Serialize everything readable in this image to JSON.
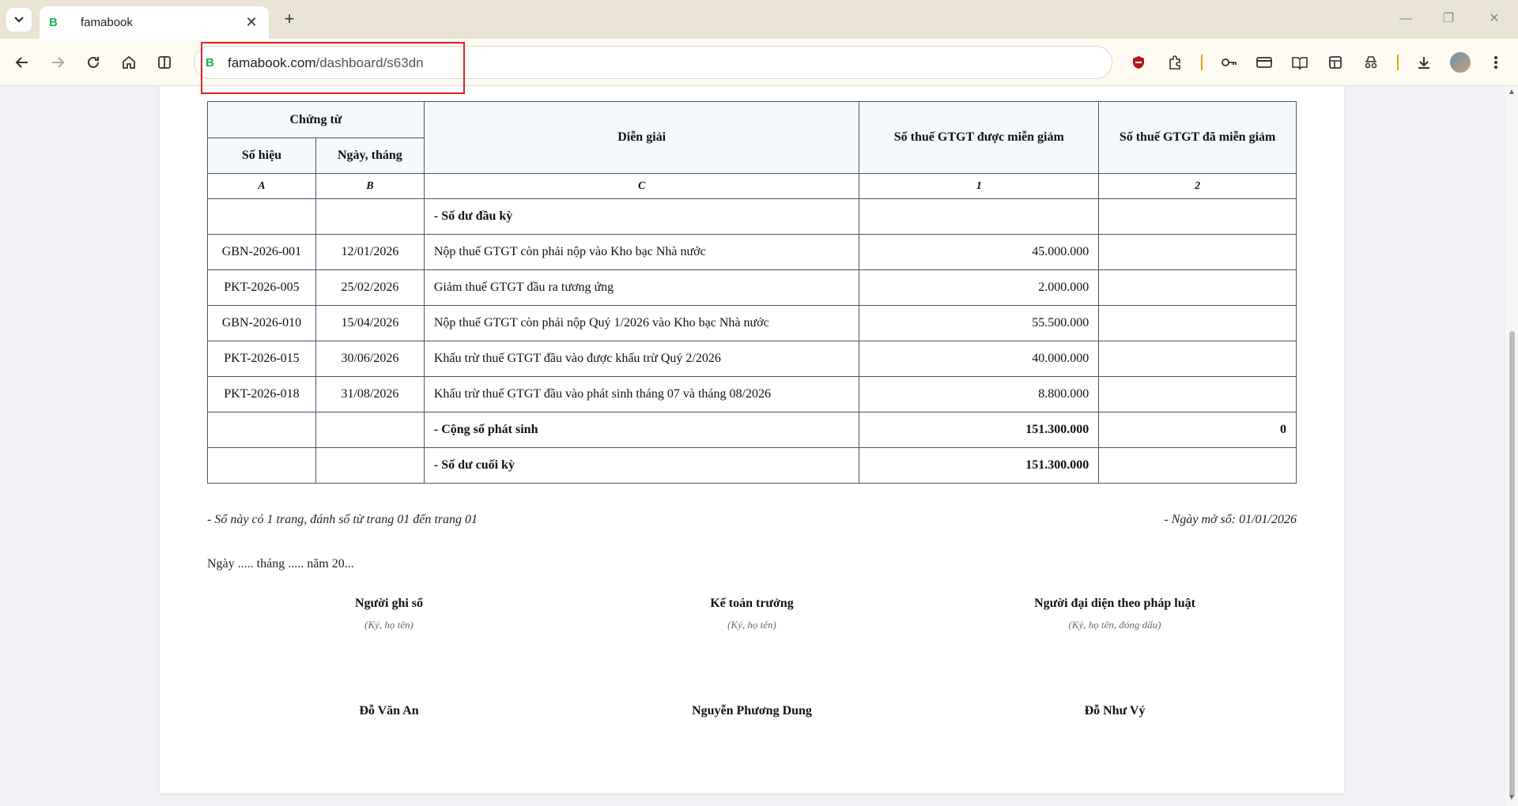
{
  "browser": {
    "tab_title": "famabook",
    "favicon_letter": "B",
    "url_host": "famabook.com",
    "url_path": "/dashboard/s63dn",
    "new_tab": "+",
    "close": "✕"
  },
  "ledger": {
    "header": {
      "voucher_group": "Chứng từ",
      "voucher_no": "Số hiệu",
      "voucher_date": "Ngày, tháng",
      "description": "Diễn giải",
      "exempt_amount": "Số thuế GTGT được miễn giảm",
      "exempted_amount": "Số thuế GTGT đã miễn giảm"
    },
    "index_row": [
      "A",
      "B",
      "C",
      "1",
      "2"
    ],
    "opening_label": "- Số dư đầu kỳ",
    "rows": [
      {
        "no": "GBN-2026-001",
        "date": "12/01/2026",
        "desc": "Nộp thuế GTGT còn phải nộp vào Kho bạc Nhà nước",
        "amount": "45.000.000",
        "done": ""
      },
      {
        "no": "PKT-2026-005",
        "date": "25/02/2026",
        "desc": "Giảm thuế GTGT đầu ra tương ứng",
        "amount": "2.000.000",
        "done": ""
      },
      {
        "no": "GBN-2026-010",
        "date": "15/04/2026",
        "desc": "Nộp thuế GTGT còn phải nộp Quý 1/2026 vào Kho bạc Nhà nước",
        "amount": "55.500.000",
        "done": ""
      },
      {
        "no": "PKT-2026-015",
        "date": "30/06/2026",
        "desc": "Khấu trừ thuế GTGT đầu vào được khấu trừ Quý 2/2026",
        "amount": "40.000.000",
        "done": ""
      },
      {
        "no": "PKT-2026-018",
        "date": "31/08/2026",
        "desc": "Khấu trừ thuế GTGT đầu vào phát sinh tháng 07 và tháng 08/2026",
        "amount": "8.800.000",
        "done": ""
      }
    ],
    "total": {
      "label": "- Cộng số phát sinh",
      "amount": "151.300.000",
      "done": "0"
    },
    "closing": {
      "label": "- Số dư cuối kỳ",
      "amount": "151.300.000"
    }
  },
  "notes": {
    "pages": "- Sổ này có 1 trang, đánh số từ trang 01 đến trang 01",
    "opened": "- Ngày mở sổ: 01/01/2026",
    "date_line": "Ngày ..... tháng ..... năm 20..."
  },
  "signatures": [
    {
      "role": "Người ghi sổ",
      "hint": "(Ký, họ tên)",
      "name": "Đỗ Văn An"
    },
    {
      "role": "Kế toán trưởng",
      "hint": "(Ký, họ tên)",
      "name": "Nguyễn Phương Dung"
    },
    {
      "role": "Người đại diện theo pháp luật",
      "hint": "(Ký, họ tên, đóng dấu)",
      "name": "Đỗ Như Vý"
    }
  ]
}
